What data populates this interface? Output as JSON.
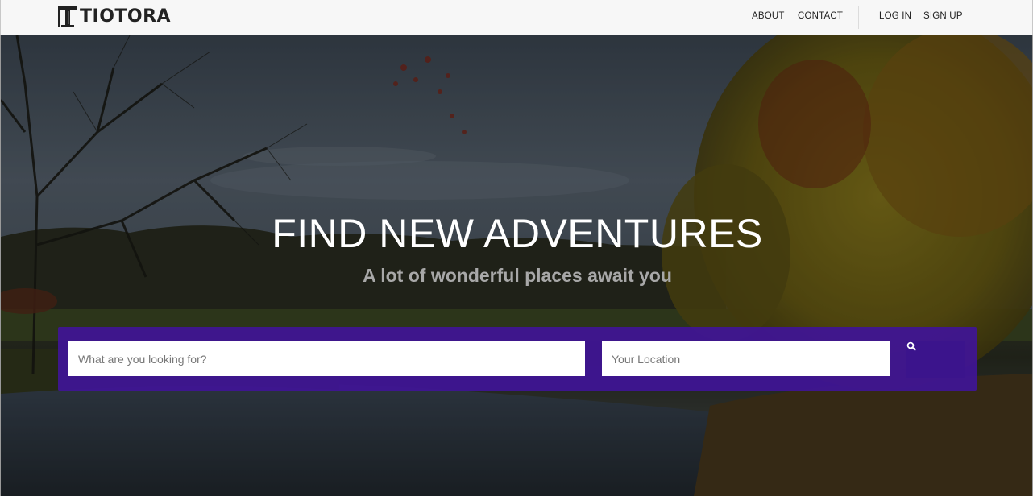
{
  "brand": {
    "name": "TIOTORA"
  },
  "nav": {
    "about": "ABOUT",
    "contact": "CONTACT",
    "login": "LOG IN",
    "signup": "SIGN UP"
  },
  "hero": {
    "title": "FIND NEW ADVENTURES",
    "subtitle": "A lot of wonderful places await you"
  },
  "search": {
    "query_placeholder": "What are you looking for?",
    "location_placeholder": "Your Location",
    "button_icon": "search-icon"
  },
  "colors": {
    "accent": "#4a17a6",
    "button": "#3b148c",
    "navbar": "#f7f7f7"
  }
}
